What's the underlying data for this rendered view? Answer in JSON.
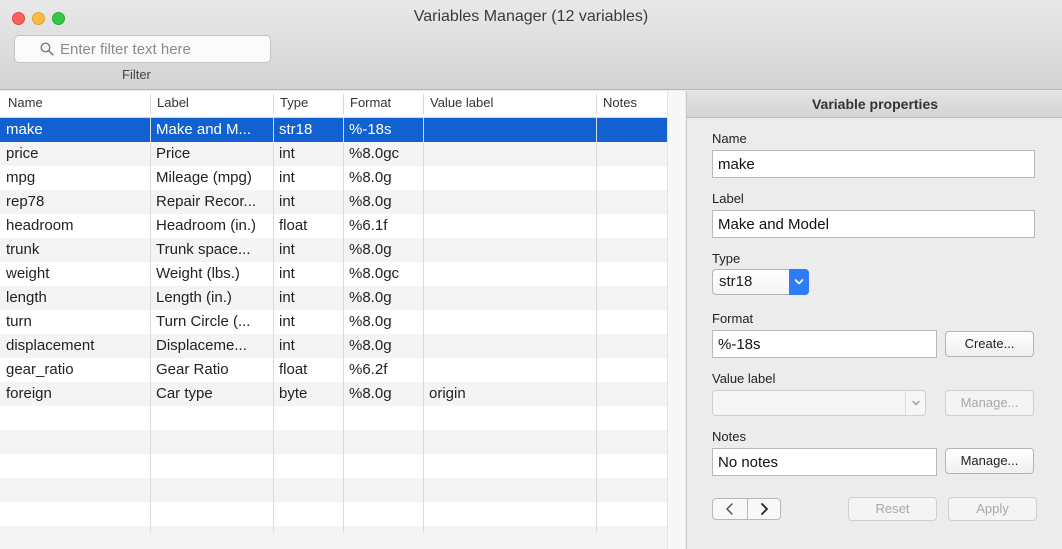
{
  "window": {
    "title": "Variables Manager (12 variables)"
  },
  "filter": {
    "placeholder": "Enter filter text here",
    "caption": "Filter"
  },
  "table": {
    "columns": [
      "Name",
      "Label",
      "Type",
      "Format",
      "Value label",
      "Notes"
    ],
    "rows": [
      {
        "name": "make",
        "label": "Make and M...",
        "type": "str18",
        "format": "%-18s",
        "value_label": "",
        "notes": "",
        "selected": true
      },
      {
        "name": "price",
        "label": "Price",
        "type": "int",
        "format": "%8.0gc",
        "value_label": "",
        "notes": ""
      },
      {
        "name": "mpg",
        "label": "Mileage (mpg)",
        "type": "int",
        "format": "%8.0g",
        "value_label": "",
        "notes": ""
      },
      {
        "name": "rep78",
        "label": "Repair Recor...",
        "type": "int",
        "format": "%8.0g",
        "value_label": "",
        "notes": ""
      },
      {
        "name": "headroom",
        "label": "Headroom (in.)",
        "type": "float",
        "format": "%6.1f",
        "value_label": "",
        "notes": ""
      },
      {
        "name": "trunk",
        "label": "Trunk space...",
        "type": "int",
        "format": "%8.0g",
        "value_label": "",
        "notes": ""
      },
      {
        "name": "weight",
        "label": "Weight (lbs.)",
        "type": "int",
        "format": "%8.0gc",
        "value_label": "",
        "notes": ""
      },
      {
        "name": "length",
        "label": "Length (in.)",
        "type": "int",
        "format": "%8.0g",
        "value_label": "",
        "notes": ""
      },
      {
        "name": "turn",
        "label": "Turn Circle (...",
        "type": "int",
        "format": "%8.0g",
        "value_label": "",
        "notes": ""
      },
      {
        "name": "displacement",
        "label": "Displaceme...",
        "type": "int",
        "format": "%8.0g",
        "value_label": "",
        "notes": ""
      },
      {
        "name": "gear_ratio",
        "label": "Gear Ratio",
        "type": "float",
        "format": "%6.2f",
        "value_label": "",
        "notes": ""
      },
      {
        "name": "foreign",
        "label": "Car type",
        "type": "byte",
        "format": "%8.0g",
        "value_label": "origin",
        "notes": ""
      }
    ]
  },
  "properties": {
    "header": "Variable properties",
    "name_label": "Name",
    "name_value": "make",
    "label_label": "Label",
    "label_value": "Make and Model",
    "type_label": "Type",
    "type_value": "str18",
    "format_label": "Format",
    "format_value": "%-18s",
    "create_button": "Create...",
    "value_label_label": "Value label",
    "value_label_value": "",
    "manage_value_label_button": "Manage...",
    "notes_label": "Notes",
    "notes_value": "No notes",
    "manage_notes_button": "Manage...",
    "prev_glyph": "<",
    "next_glyph": ">",
    "reset_button": "Reset",
    "apply_button": "Apply"
  },
  "colors": {
    "selection": "#1161d1",
    "accent": "#2f7df6"
  }
}
